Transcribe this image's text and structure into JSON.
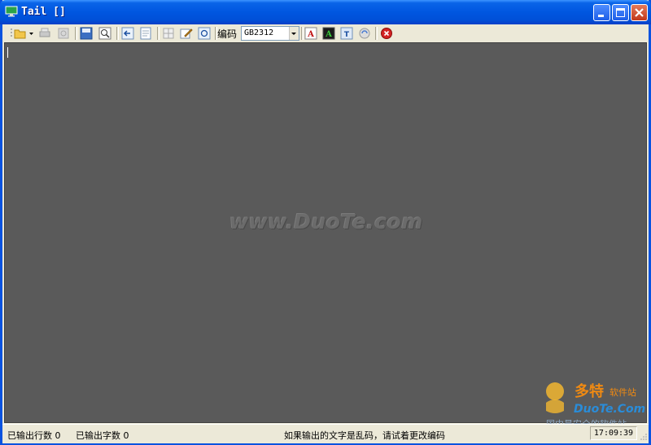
{
  "window": {
    "title": "Tail []"
  },
  "toolbar": {
    "encoding_label": "编码",
    "encoding_value": "GB2312"
  },
  "output": {
    "watermark": "www.DuoTe.com"
  },
  "corner_logo": {
    "brand_cn": "多特",
    "suffix_cn": "软件站",
    "brand_en": "DuoTe.Com",
    "slogan": "国内最安全的软件站"
  },
  "status": {
    "lines_output": "已输出行数 0",
    "chars_output": "已输出字数 0",
    "hint": "如果输出的文字是乱码，请试着更改编码",
    "time": "17:09:39"
  }
}
